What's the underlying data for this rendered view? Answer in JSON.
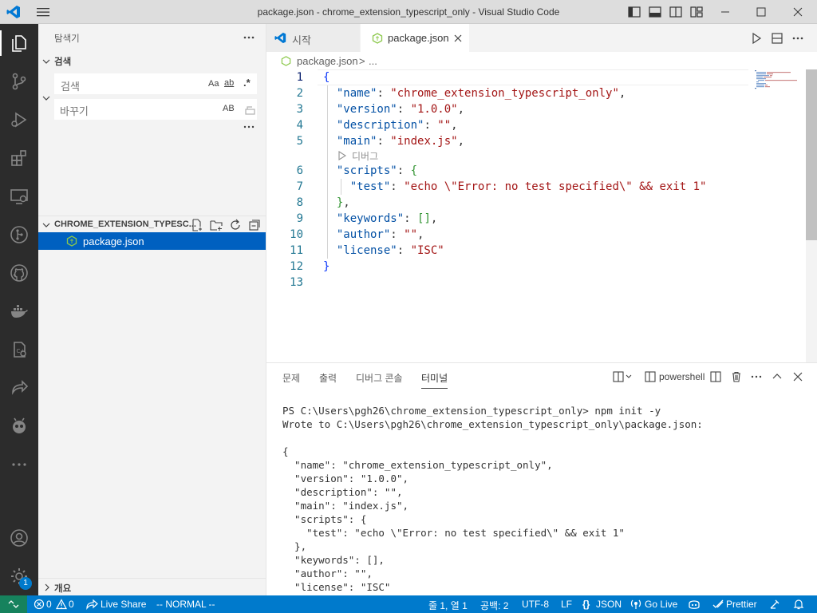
{
  "window": {
    "title": "package.json - chrome_extension_typescript_only - Visual Studio Code"
  },
  "sidebar": {
    "header": "탐색기",
    "search_section": "검색",
    "search_placeholder": "검색",
    "replace_placeholder": "바꾸기",
    "match_case": "Aa",
    "whole_word": "ab",
    "regex": ".*",
    "preserve_case": "AB",
    "folder_name": "CHROME_EXTENSION_TYPESC...",
    "files": [
      {
        "name": "package.json"
      }
    ],
    "outline": "개요"
  },
  "tabs": [
    {
      "label": "시작"
    },
    {
      "label": "package.json"
    }
  ],
  "breadcrumb": {
    "file": "package.json",
    "sep": ">",
    "rest": "..."
  },
  "editor": {
    "codelens": "디버그",
    "lines": [
      {
        "n": "1"
      },
      {
        "n": "2"
      },
      {
        "n": "3"
      },
      {
        "n": "4"
      },
      {
        "n": "5"
      },
      {
        "n": "6"
      },
      {
        "n": "7"
      },
      {
        "n": "8"
      },
      {
        "n": "9"
      },
      {
        "n": "10"
      },
      {
        "n": "11"
      },
      {
        "n": "12"
      },
      {
        "n": "13"
      }
    ],
    "code": {
      "l1": "{",
      "l2k": "\"name\"",
      "l2v": "\"chrome_extension_typescript_only\"",
      "l3k": "\"version\"",
      "l3v": "\"1.0.0\"",
      "l4k": "\"description\"",
      "l4v": "\"\"",
      "l5k": "\"main\"",
      "l5v": "\"index.js\"",
      "l6k": "\"scripts\"",
      "l6b": "{",
      "l7k": "\"test\"",
      "l7v": "\"echo \\\"Error: no test specified\\\" && exit 1\"",
      "l8": "}",
      "l9k": "\"keywords\"",
      "l9v": "[]",
      "l10k": "\"author\"",
      "l10v": "\"\"",
      "l11k": "\"license\"",
      "l11v": "\"ISC\"",
      "l12": "}"
    }
  },
  "panel": {
    "tabs": [
      "문제",
      "출력",
      "디버그 콘솔",
      "터미널"
    ],
    "active_tab": "터미널",
    "shell": "powershell",
    "terminal_lines": [
      "PS C:\\Users\\pgh26\\chrome_extension_typescript_only> npm init -y",
      "Wrote to C:\\Users\\pgh26\\chrome_extension_typescript_only\\package.json:",
      "",
      "{",
      "  \"name\": \"chrome_extension_typescript_only\",",
      "  \"version\": \"1.0.0\",",
      "  \"description\": \"\",",
      "  \"main\": \"index.js\",",
      "  \"scripts\": {",
      "    \"test\": \"echo \\\"Error: no test specified\\\" && exit 1\"",
      "  },",
      "  \"keywords\": [],",
      "  \"author\": \"\",",
      "  \"license\": \"ISC\""
    ]
  },
  "statusbar": {
    "errors": "0",
    "warnings": "0",
    "live_share": "Live Share",
    "vim_mode": "-- NORMAL --",
    "position": "줄 1, 열 1",
    "spaces": "공백: 2",
    "encoding": "UTF-8",
    "eol": "LF",
    "language": "JSON",
    "go_live": "Go Live",
    "prettier": "Prettier",
    "badge": "1"
  },
  "colors": {
    "accent": "#007acc",
    "activity_bar": "#2c2c2c",
    "selection": "#0060c0"
  }
}
